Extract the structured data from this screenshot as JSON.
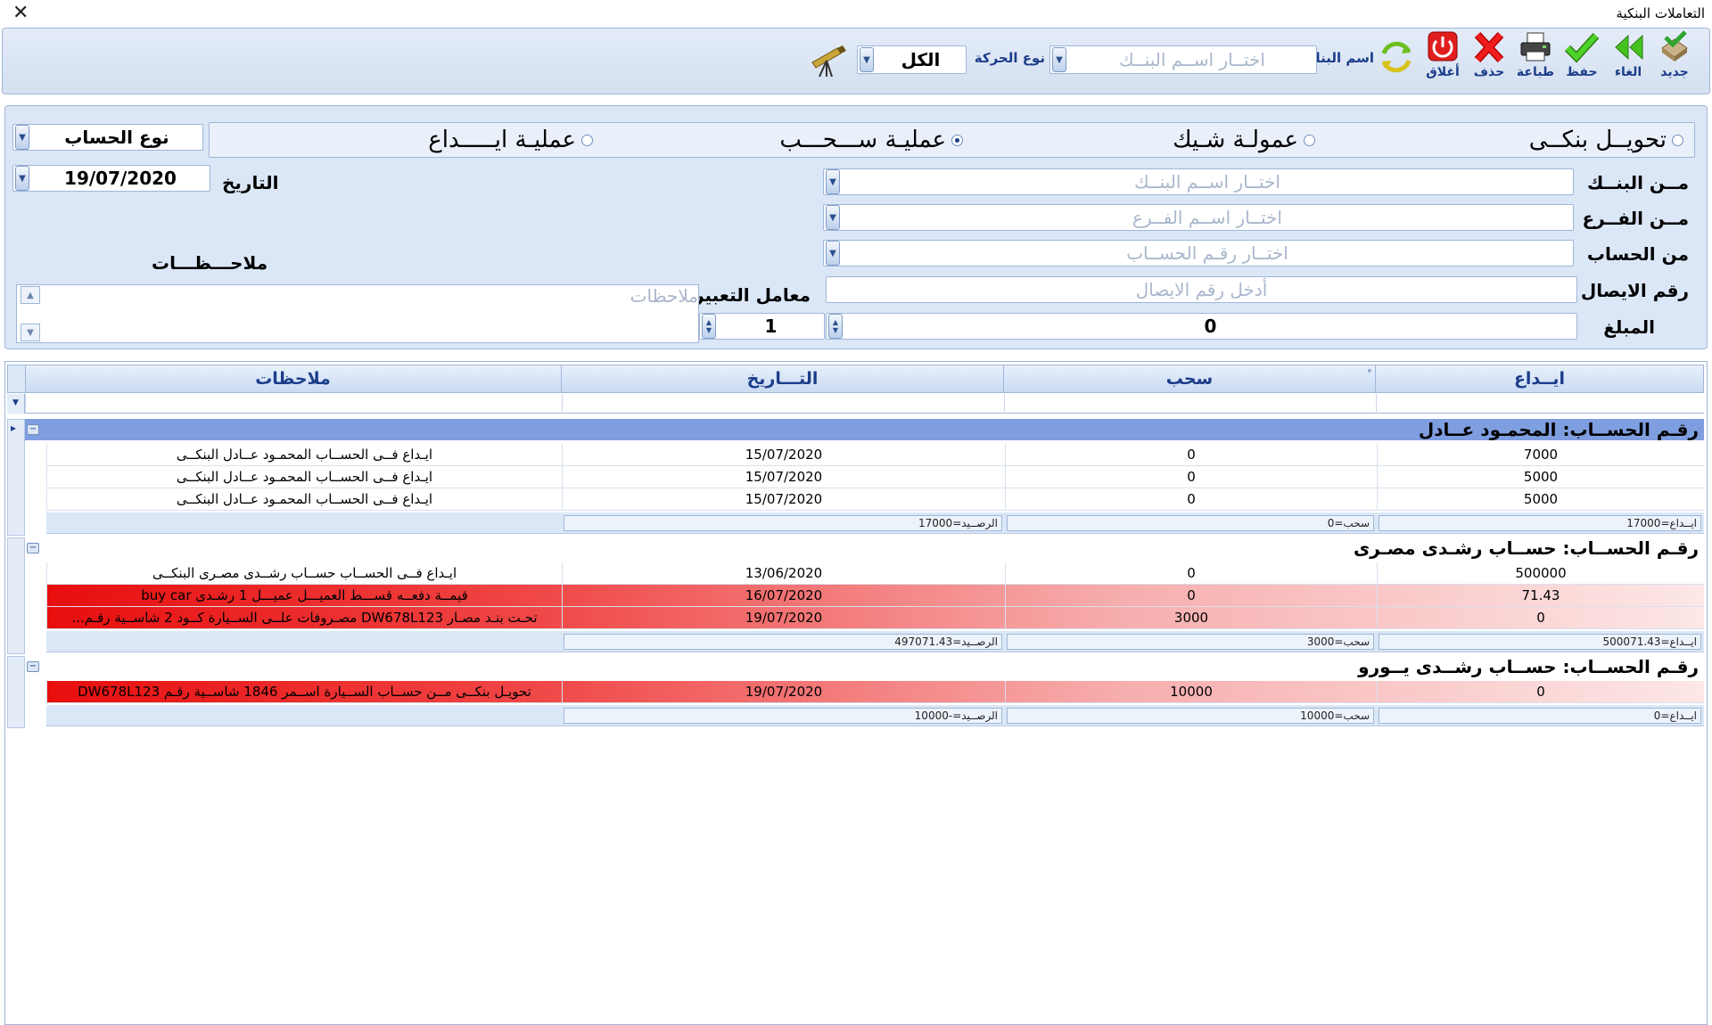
{
  "window": {
    "title": "التعاملات البنكية",
    "close_glyph": "✕"
  },
  "toolbar": {
    "new_label": "جديد",
    "undo_label": "الغاء",
    "save_label": "حفظ",
    "print_label": "طباعة",
    "delete_label": "حذف",
    "close_label": "أغلاق",
    "bank_name_label": "اسم البنك",
    "bank_placeholder": "اختــار اســم البنــك",
    "move_type_label": "نوع الحركة",
    "move_type_value": "الكل"
  },
  "form": {
    "radio_transfer": "تحويــل بنكــى",
    "radio_check_fee": "عمولـة شـيك",
    "radio_withdraw": "عمليـة ســـحـــب",
    "radio_deposit": "عمليـة ايـــــداع",
    "selected_radio": "withdraw",
    "account_type_value": "نوع الحساب",
    "from_bank_label": "مــن البنــك",
    "from_bank_placeholder": "اختــار اســم البنــك",
    "from_branch_label": "مــن الفــرع",
    "from_branch_placeholder": "اختــار اســم الفــرع",
    "from_account_label": "من الحساب",
    "from_account_placeholder": "اختــار رقـم الحســاب",
    "receipt_label": "رقم الايصال",
    "receipt_placeholder": "أدخل رقم الايصال",
    "amount_label": "المبلغ",
    "amount_value": "0",
    "rate_label": "معامل التعبير",
    "rate_value": "1",
    "date_label": "التاريخ",
    "date_value": "19/07/2020",
    "notes_label": "ملاحـــظـــات",
    "notes_placeholder": "ملاحظات"
  },
  "grid": {
    "columns": [
      "ايــداع",
      "سحب",
      "التـــاريخ",
      "ملاحظات"
    ],
    "groups": [
      {
        "header": "رقـم الحســاب:  المحمـود عــادل",
        "rows": [
          {
            "deposit": "7000",
            "withdraw": "0",
            "date": "15/07/2020",
            "notes": "ايـداع فــى الحســاب   المحمـود عــادل البنكــى",
            "highlight": false
          },
          {
            "deposit": "5000",
            "withdraw": "0",
            "date": "15/07/2020",
            "notes": "ايـداع فــى الحســاب   المحمـود عــادل البنكــى",
            "highlight": false
          },
          {
            "deposit": "5000",
            "withdraw": "0",
            "date": "15/07/2020",
            "notes": "ايـداع فــى الحســاب   المحمـود عــادل البنكــى",
            "highlight": false
          }
        ],
        "sum_deposit": "ايــداع=17000",
        "sum_withdraw": "سحب=0",
        "sum_balance": "الرصــيد=17000"
      },
      {
        "header": "رقـم الحســاب: حســاب رشـدى مصـرى",
        "rows": [
          {
            "deposit": "500000",
            "withdraw": "0",
            "date": "13/06/2020",
            "notes": "ايـداع فــى الحســاب  حســاب رشــدى مصـرى البنكــى",
            "highlight": false
          },
          {
            "deposit": "71.43",
            "withdraw": "0",
            "date": "16/07/2020",
            "notes": "قيمــة دفعــه قســـط العميـــل  عميـــل 1 رشـدى buy car",
            "highlight": true
          },
          {
            "deposit": "0",
            "withdraw": "3000",
            "date": "19/07/2020",
            "notes": "تحـت بنـد مصـار DW678L123 مصـروفات علــى الســيارة كــود 2 شاســية رقـم...",
            "highlight": true
          }
        ],
        "sum_deposit": "ايــداع=500071.43",
        "sum_withdraw": "سحب=3000",
        "sum_balance": "الرصــيد=497071.43"
      },
      {
        "header": "رقـم الحســاب: حســاب رشــدى يــورو",
        "rows": [
          {
            "deposit": "0",
            "withdraw": "10000",
            "date": "19/07/2020",
            "notes": "تحويـل بنكــى مــن حســاب الســيارة اســمر 1846 شاســية رقـم DW678L123",
            "highlight": true
          }
        ],
        "sum_deposit": "ايــداع=0",
        "sum_withdraw": "سحب=10000",
        "sum_balance": "الرصــيد=-10000"
      }
    ]
  },
  "colors": {
    "accent": "#1b3d8a",
    "panel": "#dbe7f7",
    "group_header": "#7f9ee0",
    "highlight_row": "#e80e0e"
  },
  "icons": [
    "new-icon",
    "undo-icon",
    "save-icon",
    "print-icon",
    "delete-icon",
    "power-icon",
    "refresh-icon",
    "telescope-icon",
    "filter-icon",
    "expand-arrow-icon"
  ]
}
